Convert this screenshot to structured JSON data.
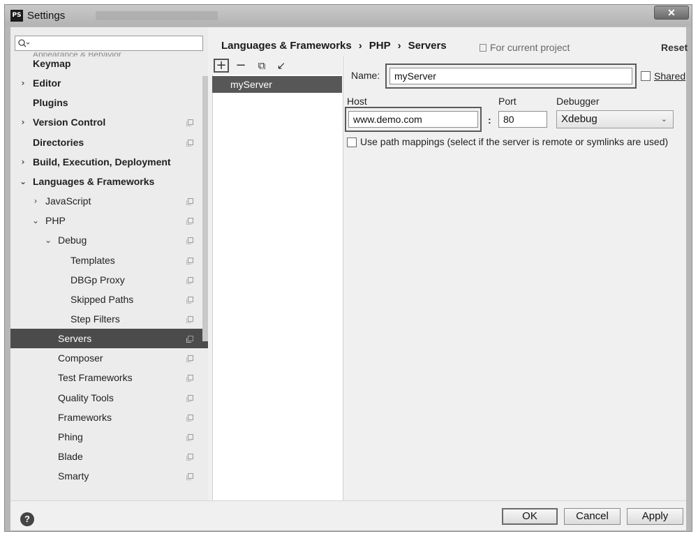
{
  "window": {
    "title": "Settings",
    "app_icon": "PS",
    "close_label": "✕"
  },
  "search": {
    "placeholder": "",
    "value": ""
  },
  "tree": {
    "cut_off_label": "Appearance & Behavior",
    "items": [
      {
        "label": "Keymap",
        "bold": true,
        "arrow": "",
        "copy": false
      },
      {
        "label": "Editor",
        "bold": true,
        "arrow": "›",
        "copy": false
      },
      {
        "label": "Plugins",
        "bold": true,
        "arrow": "",
        "copy": false
      },
      {
        "label": "Version Control",
        "bold": true,
        "arrow": "›",
        "copy": true
      },
      {
        "label": "Directories",
        "bold": true,
        "arrow": "",
        "copy": true
      },
      {
        "label": "Build, Execution, Deployment",
        "bold": true,
        "arrow": "›",
        "copy": false
      },
      {
        "label": "Languages & Frameworks",
        "bold": true,
        "arrow": "⌄",
        "copy": false
      },
      {
        "label": "JavaScript",
        "bold": false,
        "arrow": "›",
        "copy": true
      },
      {
        "label": "PHP",
        "bold": false,
        "arrow": "⌄",
        "copy": true
      },
      {
        "label": "Debug",
        "bold": false,
        "arrow": "⌄",
        "copy": true
      },
      {
        "label": "Templates",
        "bold": false,
        "arrow": "",
        "copy": true
      },
      {
        "label": "DBGp Proxy",
        "bold": false,
        "arrow": "",
        "copy": true
      },
      {
        "label": "Skipped Paths",
        "bold": false,
        "arrow": "",
        "copy": true
      },
      {
        "label": "Step Filters",
        "bold": false,
        "arrow": "",
        "copy": true
      },
      {
        "label": "Servers",
        "bold": false,
        "arrow": "",
        "copy": true,
        "selected": true
      },
      {
        "label": "Composer",
        "bold": false,
        "arrow": "",
        "copy": true
      },
      {
        "label": "Test Frameworks",
        "bold": false,
        "arrow": "",
        "copy": true
      },
      {
        "label": "Quality Tools",
        "bold": false,
        "arrow": "",
        "copy": true
      },
      {
        "label": "Frameworks",
        "bold": false,
        "arrow": "",
        "copy": true
      },
      {
        "label": "Phing",
        "bold": false,
        "arrow": "",
        "copy": true
      },
      {
        "label": "Blade",
        "bold": false,
        "arrow": "",
        "copy": true
      },
      {
        "label": "Smarty",
        "bold": false,
        "arrow": "",
        "copy": true
      }
    ]
  },
  "toolbar": {
    "add": "+",
    "remove": "−",
    "copy": "⧉",
    "import": "↙"
  },
  "servers": [
    "myServer"
  ],
  "breadcrumb": [
    "Languages & Frameworks",
    "PHP",
    "Servers"
  ],
  "breadcrumb_sep": "›",
  "for_current_project": "For current project",
  "reset": "Reset",
  "form": {
    "name_label": "Name:",
    "name_value": "myServer",
    "shared_label": "Shared",
    "host_label": "Host",
    "host_value": "www.demo.com",
    "colon": ":",
    "port_label": "Port",
    "port_value": "80",
    "debugger_label": "Debugger",
    "debugger_value": "Xdebug",
    "path_mappings_label": "Use path mappings (select if the server is remote or symlinks are used)"
  },
  "buttons": {
    "help": "?",
    "ok": "OK",
    "cancel": "Cancel",
    "apply": "Apply"
  }
}
